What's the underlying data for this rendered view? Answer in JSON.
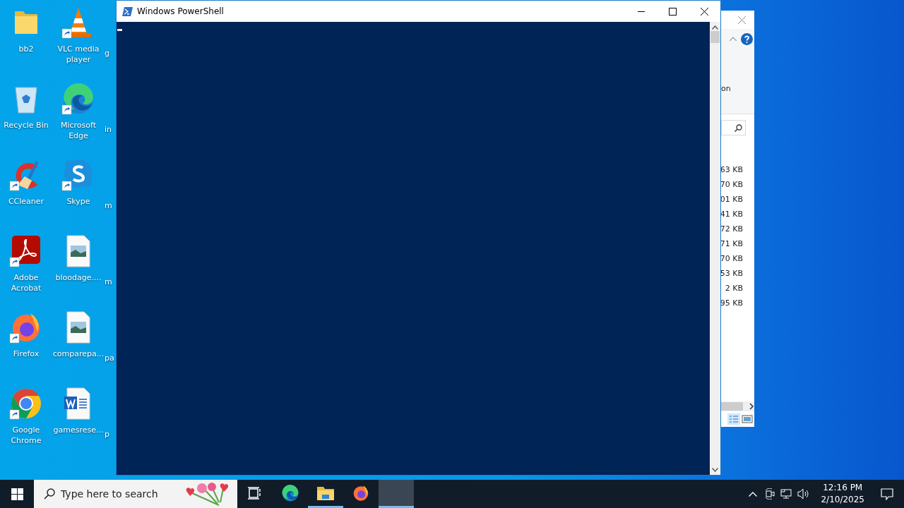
{
  "desktop_icons": [
    {
      "label": "bb2",
      "kind": "folder",
      "shortcut": false
    },
    {
      "label": "Recycle Bin",
      "kind": "recycle-bin",
      "shortcut": false
    },
    {
      "label": "CCleaner",
      "kind": "ccleaner",
      "shortcut": true
    },
    {
      "label": "Adobe Acrobat",
      "kind": "acrobat",
      "shortcut": true
    },
    {
      "label": "Firefox",
      "kind": "firefox",
      "shortcut": true
    },
    {
      "label": "Google Chrome",
      "kind": "chrome",
      "shortcut": true
    },
    {
      "label": "VLC media player",
      "kind": "vlc",
      "shortcut": true
    },
    {
      "label": "Microsoft Edge",
      "kind": "edge",
      "shortcut": true
    },
    {
      "label": "Skype",
      "kind": "skype",
      "shortcut": true
    },
    {
      "label": "bloodage....",
      "kind": "image-file",
      "shortcut": false
    },
    {
      "label": "comparepa...",
      "kind": "image-file",
      "shortcut": false
    },
    {
      "label": "gamesrese...",
      "kind": "word-doc",
      "shortcut": false
    },
    {
      "label": "g",
      "kind": "partial"
    },
    {
      "label": "in",
      "kind": "partial"
    },
    {
      "label": "m",
      "kind": "partial"
    },
    {
      "label": "m",
      "kind": "partial"
    },
    {
      "label": "pa",
      "kind": "partial"
    },
    {
      "label": "p",
      "kind": "partial"
    }
  ],
  "explorer_window": {
    "ribbon_text": "on",
    "sizes": [
      "63 KB",
      "70 KB",
      "01 KB",
      "41 KB",
      "72 KB",
      "71 KB",
      "70 KB",
      "53 KB",
      "2 KB",
      "95 KB"
    ]
  },
  "powershell_window": {
    "title": "Windows PowerShell"
  },
  "taskbar": {
    "search": {
      "placeholder": "Type here to search"
    },
    "apps": [
      {
        "kind": "task-view",
        "running": false,
        "selected": false
      },
      {
        "kind": "edge",
        "running": false,
        "selected": false
      },
      {
        "kind": "explorer",
        "running": true,
        "selected": false
      },
      {
        "kind": "firefox",
        "running": false,
        "selected": false
      },
      {
        "kind": "blank",
        "running": true,
        "selected": true
      }
    ],
    "clock": {
      "time": "12:16 PM",
      "date": "2/10/2025"
    }
  }
}
